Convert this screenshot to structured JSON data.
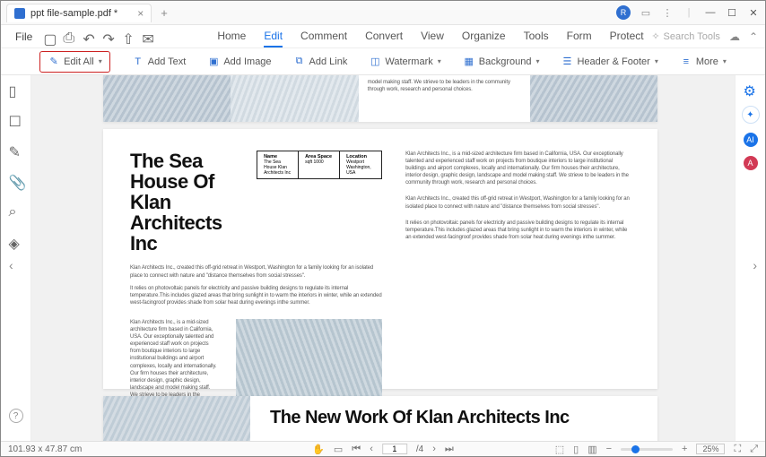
{
  "title": {
    "filename": "ppt file-sample.pdf *"
  },
  "menubar": {
    "file": "File",
    "tabs": [
      "Home",
      "Edit",
      "Comment",
      "Convert",
      "View",
      "Organize",
      "Tools",
      "Form",
      "Protect"
    ],
    "active_index": 1,
    "search_placeholder": "Search Tools"
  },
  "toolbar": {
    "edit_all": "Edit All",
    "add_text": "Add Text",
    "add_image": "Add Image",
    "add_link": "Add Link",
    "watermark": "Watermark",
    "background": "Background",
    "header_footer": "Header & Footer",
    "more": "More"
  },
  "document": {
    "page1": {
      "heading": "The Sea House Of Klan Architects Inc",
      "info": {
        "name_label": "Name",
        "name_value": "The Sea House Klan Architects Inc",
        "area_label": "Area Space",
        "area_value": "sqft 1000",
        "loc_label": "Location",
        "loc_value": "Westport Washington, USA"
      },
      "p_right_a": "Klan Architects Inc., is a mid-sized architecture firm based in California, USA. Our exceptionally talented and experienced staff work on projects from boutique interiors to large institutional buildings and airport complexes, locally and internationally. Our firm houses their architecture, interior design, graphic design, landscape and model making staff. We strieve to be leaders in the community through work, research and personal choices.",
      "p_right_b": "Klan Architects Inc., created this off-grid retreat in Westport, Washington for a family looking for an isolated place to connect with nature and \"distance themselves from social stresses\".",
      "p_right_c": "It relies on photovoltaic panels for electricity and passive building designs to regulate its internal temperature.This includes glazed areas that bring sunlight in to warm the interiors in winter, while an extended west-facingroof provides shade from solar heat during evenings inthe summer.",
      "p_left_a": "Klan Architects Inc., created this off-grid retreat in Westport, Washington for a family looking for an isolated place to connect with nature and \"distance themselves from social stresses\".",
      "p_left_b": "It relies on photovoltaic panels for electricity and passive building designs to regulate its internal temperature.This includes glazed areas that bring sunlight in to warm the interiors in winter, while an extended west-facingroof provides shade from solar heat during evenings inthe summer.",
      "p_left_c": "Klan Architects Inc., is a mid-sized architecture firm based in California, USA. Our exceptionally talented and experienced staff work on projects from boutique interiors to large institutional buildings and airport complexes, locally and internationally. Our firm houses their architecture, interior design, graphic design, landscape and model making staff. We strieve to be leaders in the community through work, research and personal choices.",
      "top_strip": "model making staff. We strieve to be leaders in the community through work, research and personal choices."
    },
    "page2": {
      "heading": "The New Work Of Klan Architects Inc"
    }
  },
  "status": {
    "coords": "101.93 x 47.87 cm",
    "page_current": "1",
    "page_sep": "/4",
    "zoom_value": "25%"
  }
}
